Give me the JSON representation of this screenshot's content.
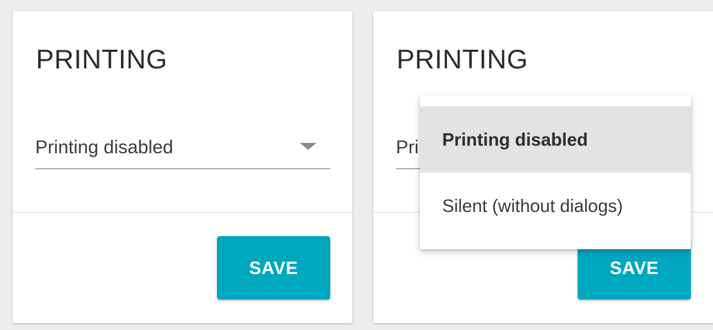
{
  "left_card": {
    "title": "PRINTING",
    "select": {
      "value": "Printing disabled"
    },
    "save_label": "SAVE"
  },
  "right_card": {
    "title": "PRINTING",
    "select": {
      "value": "Printing disabled",
      "visible_value": "Pri"
    },
    "save_label": "SAVE",
    "dropdown": {
      "open": true,
      "options": [
        {
          "label": "Printing disabled",
          "selected": true
        },
        {
          "label": "Silent (without dialogs)",
          "selected": false
        }
      ]
    }
  },
  "colors": {
    "accent": "#00a8bf",
    "background": "#ededed",
    "card": "#ffffff",
    "selected_option": "#e3e3e3"
  },
  "icons": {
    "select_arrow": "chevron-down-icon"
  }
}
